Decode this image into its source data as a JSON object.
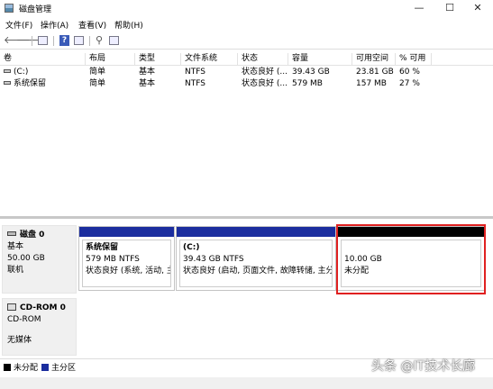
{
  "window": {
    "title": "磁盘管理",
    "minimize_glyph": "—",
    "maximize_glyph": "☐",
    "close_glyph": "✕"
  },
  "menu": [
    "文件(F)",
    "操作(A)",
    "查看(V)",
    "帮助(H)"
  ],
  "toolbar": [
    "back-icon",
    "forward-icon",
    "console-tree-icon",
    "properties-icon",
    "help-icon",
    "details-icon",
    "rescan-icon",
    "list-view-icon"
  ],
  "volume_table": {
    "columns": [
      "卷",
      "布局",
      "类型",
      "文件系统",
      "状态",
      "容量",
      "可用空间",
      "% 可用"
    ],
    "rows": [
      [
        "(C:)",
        "简单",
        "基本",
        "NTFS",
        "状态良好 (...",
        "39.43 GB",
        "23.81 GB",
        "60 %"
      ],
      [
        "系统保留",
        "简单",
        "基本",
        "NTFS",
        "状态良好 (...",
        "579 MB",
        "157 MB",
        "27 %"
      ]
    ]
  },
  "disk0": {
    "name": "磁盘 0",
    "type": "基本",
    "size": "50.00 GB",
    "status": "联机",
    "partitions": [
      {
        "name": "系统保留",
        "size_fs": "579 MB NTFS",
        "status": "状态良好 (系统, 活动, 主分区)",
        "bar_color": "#1b2d9e"
      },
      {
        "name": "(C:)",
        "size_fs": "39.43 GB NTFS",
        "status": "状态良好 (启动, 页面文件, 故障转储, 主分区)",
        "bar_color": "#1b2d9e"
      },
      {
        "name": "",
        "size_fs": "10.00 GB",
        "status": "未分配",
        "bar_color": "#000000"
      }
    ]
  },
  "cdrom0": {
    "name": "CD-ROM 0",
    "type": "CD-ROM",
    "status": "无媒体"
  },
  "legend": [
    {
      "label": "未分配",
      "color": "#000000"
    },
    {
      "label": "主分区",
      "color": "#1b2d9e"
    }
  ],
  "watermark": "头条 @IT技术长廊"
}
